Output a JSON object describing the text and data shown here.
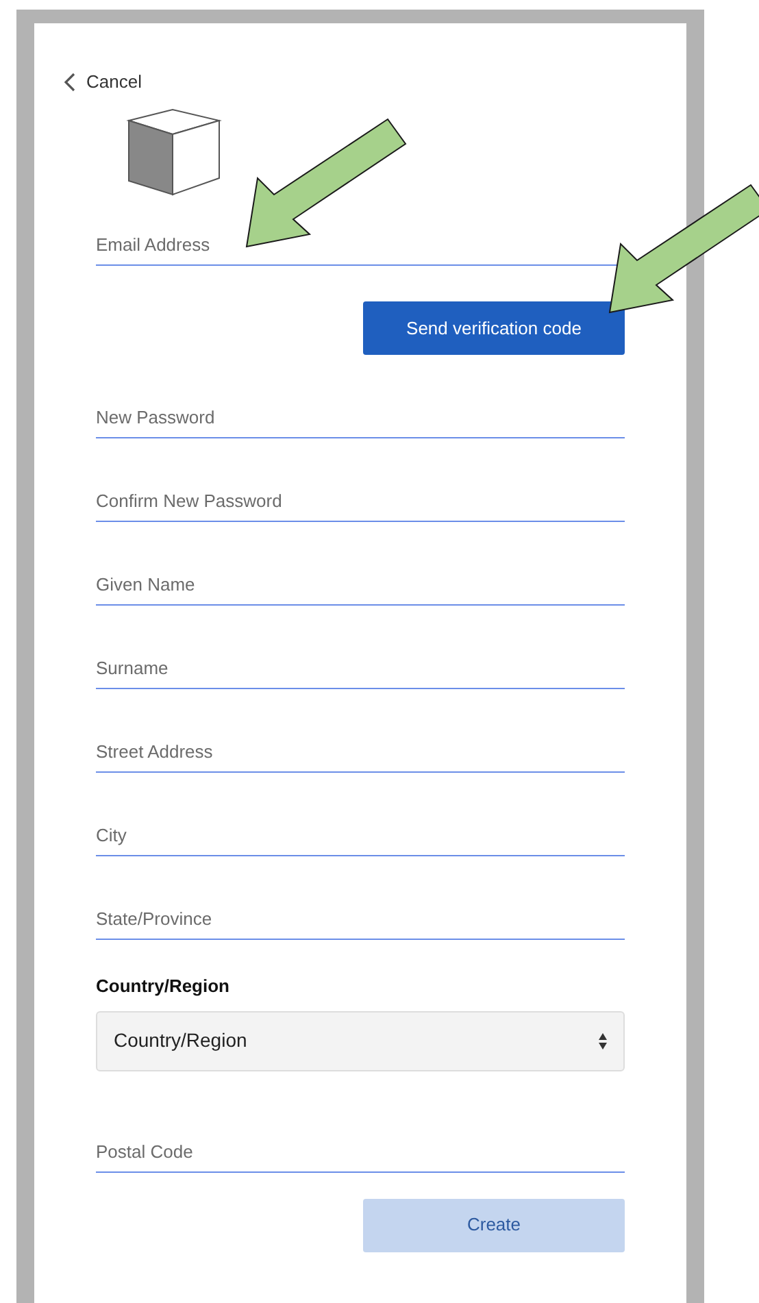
{
  "cancel_link": "Cancel",
  "email_field": {
    "placeholder": "Email Address"
  },
  "send_button": "Send verification code",
  "fields": [
    {
      "placeholder": "New Password"
    },
    {
      "placeholder": "Confirm New Password"
    },
    {
      "placeholder": "Given Name"
    },
    {
      "placeholder": "Surname"
    },
    {
      "placeholder": "Street Address"
    },
    {
      "placeholder": "City"
    },
    {
      "placeholder": "State/Province"
    }
  ],
  "country": {
    "label": "Country/Region",
    "value": "Country/Region"
  },
  "postal_field": {
    "placeholder": "Postal Code"
  },
  "create_button": {
    "label": "Create",
    "disabled": true
  }
}
